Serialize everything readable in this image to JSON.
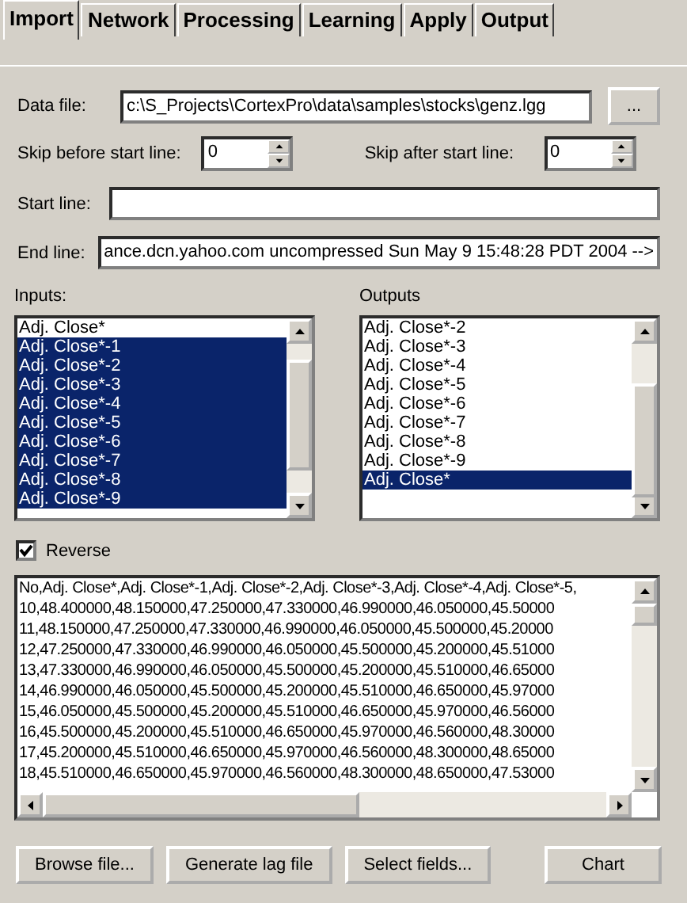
{
  "tabs": [
    {
      "label": "Import",
      "selected": true
    },
    {
      "label": "Network",
      "selected": false
    },
    {
      "label": "Processing",
      "selected": false
    },
    {
      "label": "Learning",
      "selected": false
    },
    {
      "label": "Apply",
      "selected": false
    },
    {
      "label": "Output",
      "selected": false
    }
  ],
  "data_file": {
    "label": "Data file:",
    "value": "c:\\S_Projects\\CortexPro\\data\\samples\\stocks\\genz.lgg",
    "browse_button": "..."
  },
  "skip_before": {
    "label": "Skip before start line:",
    "value": "0"
  },
  "skip_after": {
    "label": "Skip after start line:",
    "value": "0"
  },
  "start_line": {
    "label": "Start line:"
  },
  "end_line": {
    "label": "End line:",
    "value": "ance.dcn.yahoo.com uncompressed Sun May  9 15:48:28 PDT 2004 -->"
  },
  "inputs": {
    "label": "Inputs:",
    "items": [
      {
        "text": "Adj. Close*",
        "selected": false
      },
      {
        "text": "Adj. Close*-1",
        "selected": true
      },
      {
        "text": "Adj. Close*-2",
        "selected": true
      },
      {
        "text": "Adj. Close*-3",
        "selected": true
      },
      {
        "text": "Adj. Close*-4",
        "selected": true
      },
      {
        "text": "Adj. Close*-5",
        "selected": true
      },
      {
        "text": "Adj. Close*-6",
        "selected": true
      },
      {
        "text": "Adj. Close*-7",
        "selected": true
      },
      {
        "text": "Adj. Close*-8",
        "selected": true
      },
      {
        "text": "Adj. Close*-9",
        "selected": true
      }
    ]
  },
  "outputs": {
    "label": "Outputs",
    "items": [
      {
        "text": "Adj. Close*-2",
        "selected": false
      },
      {
        "text": "Adj. Close*-3",
        "selected": false
      },
      {
        "text": "Adj. Close*-4",
        "selected": false
      },
      {
        "text": "Adj. Close*-5",
        "selected": false
      },
      {
        "text": "Adj. Close*-6",
        "selected": false
      },
      {
        "text": "Adj. Close*-7",
        "selected": false
      },
      {
        "text": "Adj. Close*-8",
        "selected": false
      },
      {
        "text": "Adj. Close*-9",
        "selected": false
      },
      {
        "text": "Adj. Close*",
        "selected": true
      }
    ]
  },
  "reverse": {
    "label": "Reverse",
    "checked": true
  },
  "data_preview": [
    "No,Adj. Close*,Adj. Close*-1,Adj. Close*-2,Adj. Close*-3,Adj. Close*-4,Adj. Close*-5,",
    "10,48.400000,48.150000,47.250000,47.330000,46.990000,46.050000,45.50000",
    "11,48.150000,47.250000,47.330000,46.990000,46.050000,45.500000,45.20000",
    "12,47.250000,47.330000,46.990000,46.050000,45.500000,45.200000,45.51000",
    "13,47.330000,46.990000,46.050000,45.500000,45.200000,45.510000,46.65000",
    "14,46.990000,46.050000,45.500000,45.200000,45.510000,46.650000,45.97000",
    "15,46.050000,45.500000,45.200000,45.510000,46.650000,45.970000,46.56000",
    "16,45.500000,45.200000,45.510000,46.650000,45.970000,46.560000,48.30000",
    "17,45.200000,45.510000,46.650000,45.970000,46.560000,48.300000,48.65000",
    "18,45.510000,46.650000,45.970000,46.560000,48.300000,48.650000,47.53000"
  ],
  "buttons": [
    "Browse file...",
    "Generate lag file",
    "Select fields...",
    "Chart"
  ]
}
